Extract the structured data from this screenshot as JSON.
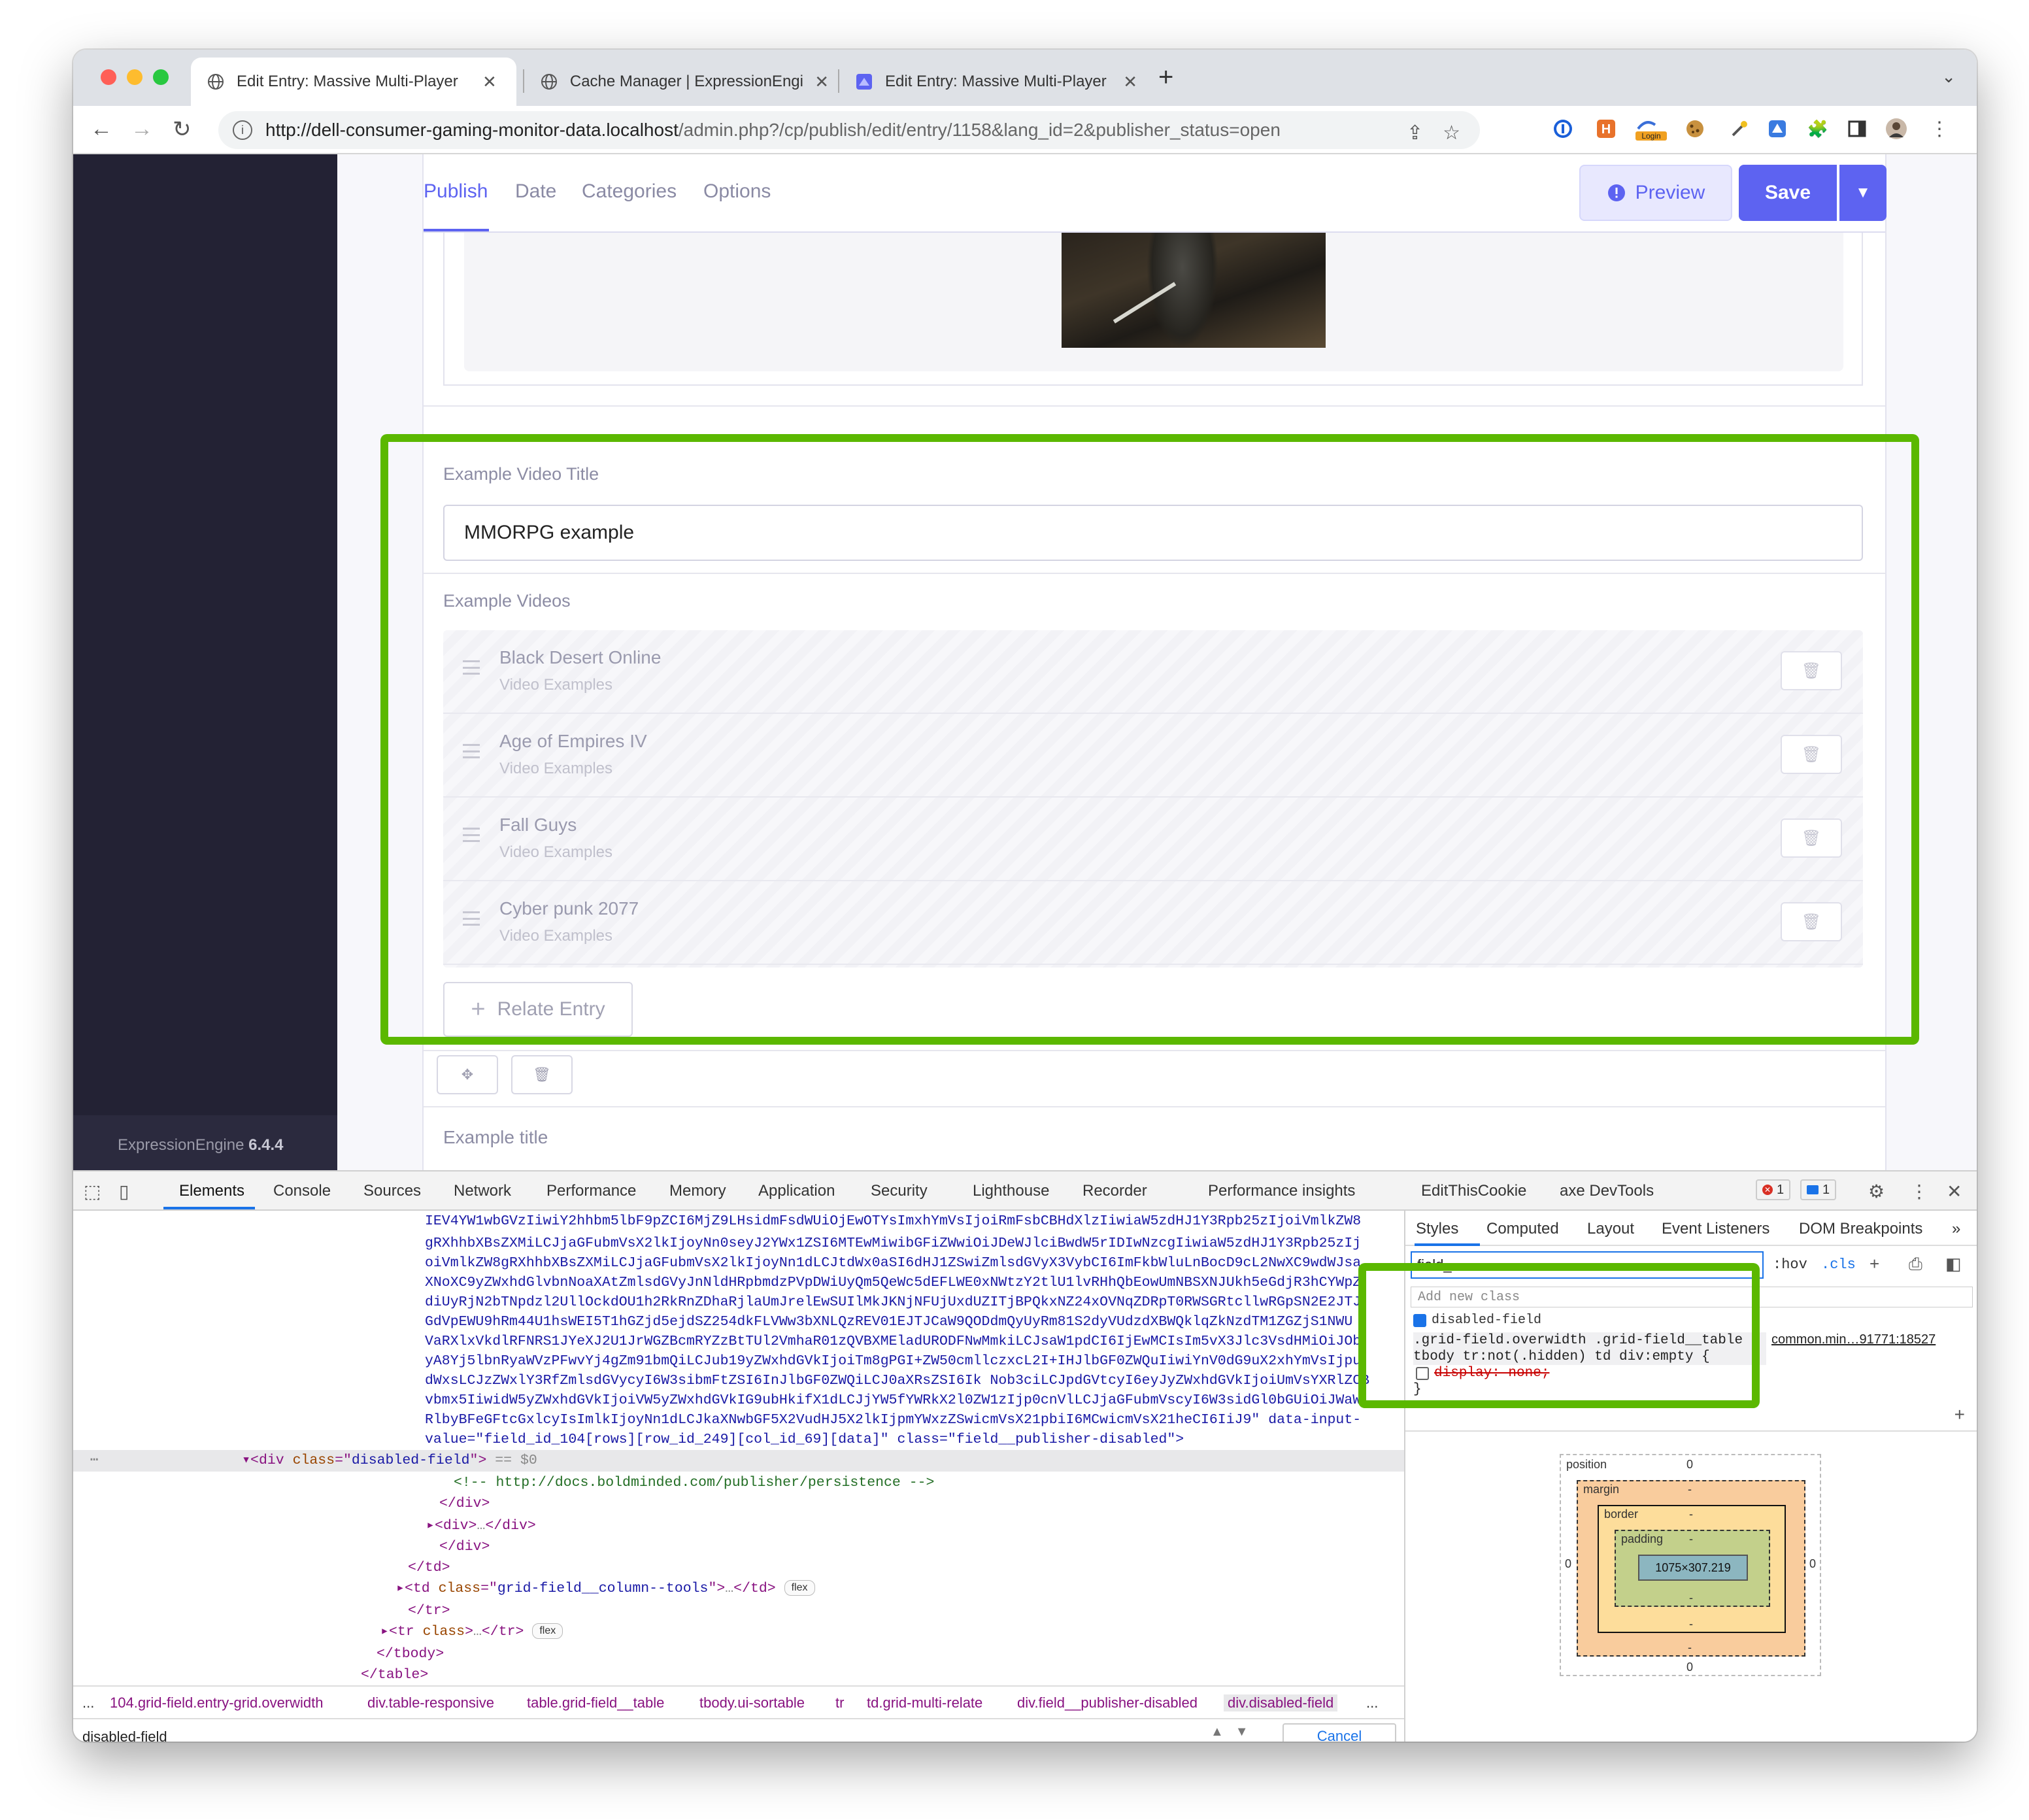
{
  "browser": {
    "tabs": [
      {
        "title": "Edit Entry: Massive Multi-Player",
        "active": true
      },
      {
        "title": "Cache Manager | ExpressionEngine",
        "active": false
      },
      {
        "title": "Edit Entry: Massive Multi-Player",
        "active": false
      }
    ],
    "url_host": "http://dell-consumer-gaming-monitor-data.localhost",
    "url_path": "/admin.php?/cp/publish/edit/entry/1158&lang_id=2&publisher_status=open",
    "extensions": [
      "1password-icon",
      "h-extension-icon",
      "login-extension-icon",
      "cookie-icon",
      "eyedropper-icon",
      "multi-extension-icon",
      "puzzle-icon",
      "sidepanel-icon",
      "profile-avatar"
    ],
    "ext_login_label": "Login"
  },
  "sidebar": {
    "app_name": "ExpressionEngine",
    "version": "6.4.4"
  },
  "publish": {
    "tabs": [
      "Publish",
      "Date",
      "Categories",
      "Options"
    ],
    "preview_label": "Preview",
    "save_label": "Save"
  },
  "fields": {
    "video_title_label": "Example Video Title",
    "video_title_value": "MMORPG example",
    "videos_label": "Example Videos",
    "videos": [
      {
        "title": "Black Desert Online",
        "channel": "Video Examples"
      },
      {
        "title": "Age of Empires IV",
        "channel": "Video Examples"
      },
      {
        "title": "Fall Guys",
        "channel": "Video Examples"
      },
      {
        "title": "Cyber punk 2077",
        "channel": "Video Examples"
      }
    ],
    "relate_label": "Relate Entry",
    "example_title_label": "Example title"
  },
  "devtools": {
    "tabs": [
      "Elements",
      "Console",
      "Sources",
      "Network",
      "Performance",
      "Memory",
      "Application",
      "Security",
      "Lighthouse",
      "Recorder",
      "Performance insights",
      "EditThisCookie",
      "axe DevTools"
    ],
    "errors_count": "1",
    "messages_count": "1",
    "code_lines": [
      "IEV4YW1wbGVzIiwiY2hhbm5lbF9pZCI6MjZ9LHsidmFsdWUiOjEwOTYsImxhYmVsIjoiRmFsbCBHdXlzIiwiaW5zdHJ1Y3Rpb25zIjoiVmlkZW8",
      "gRXhhbXBsZXMiLCJjaGFubmVsX2lkIjoyNn0seyJ2YWx1ZSI6MTEwMiwibGFiZWwiOiJDeWJlciBwdW5rIDIwNzcgIiwiaW5zdHJ1Y3Rpb25zIj",
      "oiVmlkZW8gRXhhbXBsZXMiLCJjaGFubmVsX2lkIjoyNn1dLCJtdWx0aSI6dHJ1ZSwiZmlsdGVyX3VybCI6ImFkbWluLnBocD9cL2NwXC9wdWJsa",
      "XNoXC9yZWxhdGlvbnNoaXAtZmlsdGVyJnNldHRpbmdzPVpDWiUyQm5QeWc5dEFLWE0xNWtzY2tlU1lvRHhQbEowUmNBSXNJUkh5eGdjR3hCYWpZ",
      "diUyRjN2bTNpdzl2UllOckdOU1h2RkRnZDhaRjlaUmJrelEwSUIlMkJKNjNFUjUxdUZITjBPQkxNZ24xOVNqZDRpT0RWSGRtcllwRGpSN2E2JTJ",
      "GdVpEWU9hRm44U1hsWEI5T1hGZjd5ejdSZ254dkFLVWw3bXNLQzREV01EJTJCaW9QODdmQyUyRm81S2dyVUdzdXBWQklqZkNzdTM1ZGZjS1NWU",
      "VaRXlxVkdlRFNRS1JYeXJ2U1JrWGZBcmRYZzBtTUl2VmhaR01zQVBXMEladURODFNwMmkiLCJsaW1pdCI6IjEwMCIsIm5vX3Jlc3VsdHMiOiJOb",
      "yA8Yj5lbnRyaWVzPFwvYj4gZm91bmQiLCJub19yZWxhdGVkIjoiTm8gPGI+ZW50cmllczxcL2I+IHJlbGF0ZWQuIiwiYnV0dG9uX2xhYmVsIjpu",
      "dWxsLCJzZWxlY3RfZmlsdGVycyI6W3sibmFtZSI6InJlbGF0ZWQiLCJ0aXRsZSI6Ik Nob3ciLCJpdGVtcyI6eyJyZWxhdGVkIjoiUmVsYXRlZCB",
      "vbmx5IiwidW5yZWxhdGVkIjoiVW5yZWxhdGVkIG9ubHkifX1dLCJjYW5fYWRkX2l0ZW1zIjp0cnVlLCJjaGFubmVscyI6W3sidGl0bGUiOiJWaW",
      "RlbyBFeGFtcGxlcyIsImlkIjoyNn1dLCJkaXNwbGF5X2VudHJ5X2lkIjpmYWxzZSwicmVsX21pbiI6MCwicmVsX21heCI6IiJ9\" data-input-",
      "value=\"field_id_104[rows][row_id_249][col_id_69][data]\" class=\"field__publisher-disabled\">"
    ],
    "selected_tag": "div",
    "selected_class": "disabled-field",
    "selected_suffix": "== $0",
    "comment": "<!-- http://docs.boldminded.com/publisher/persistence -->",
    "td_tools_class": "grid-field__column--tools",
    "breadcrumbs": [
      "...",
      "104.grid-field.entry-grid.overwidth",
      "div.table-responsive",
      "table.grid-field__table",
      "tbody.ui-sortable",
      "tr",
      "td.grid-multi-relate",
      "div.field__publisher-disabled",
      "div.disabled-field",
      "..."
    ],
    "search_query": "disabled-field",
    "search_cancel": "Cancel",
    "styles_tabs": [
      "Styles",
      "Computed",
      "Layout",
      "Event Listeners",
      "DOM Breakpoints"
    ],
    "filter_value": "field_",
    "hov": ":hov",
    "cls": ".cls",
    "add_class_placeholder": "Add new class",
    "class_toggle": "disabled-field",
    "rule_selector": ".grid-field.overwidth .grid-field__table tbody tr:not(.hidden) td div:empty {",
    "rule_prop": "display: none;",
    "rule_close": "}",
    "rule_source": "common.min…91771:18527",
    "box_model": {
      "position_label": "position",
      "position_value": "0",
      "margin_label": "margin",
      "border_label": "border",
      "padding_label": "padding",
      "content_size": "1075×307.219",
      "dash": "-",
      "zero": "0"
    }
  },
  "colors": {
    "accent": "#5d63f1",
    "highlight": "#5bb800",
    "sidebar": "#232234"
  }
}
